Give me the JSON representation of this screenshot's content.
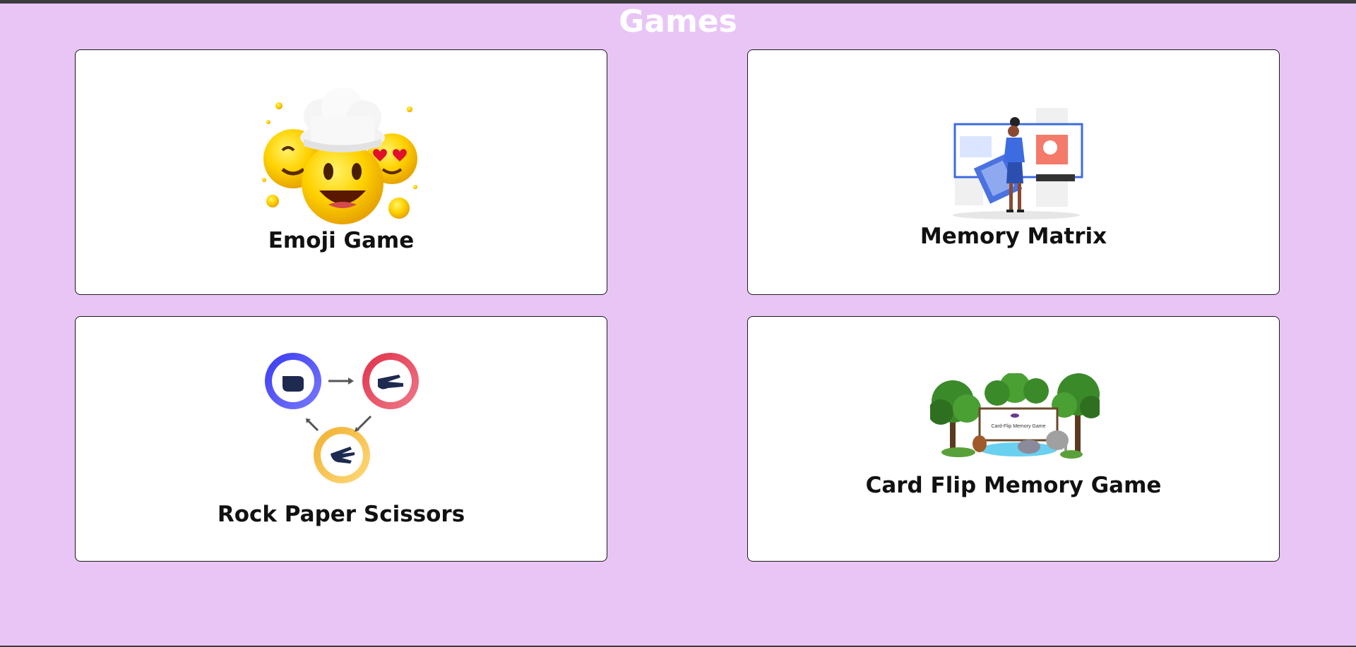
{
  "page": {
    "title": "Games"
  },
  "games": [
    {
      "label": "Emoji Game",
      "icon": "emoji-faces-icon"
    },
    {
      "label": "Memory Matrix",
      "icon": "memory-matrix-illustration"
    },
    {
      "label": "Rock Paper Scissors",
      "icon": "rock-paper-scissors-icon"
    },
    {
      "label": "Card Flip Memory Game",
      "icon": "card-flip-jungle-illustration"
    }
  ],
  "card_flip_banner_text": "Card-Flip Memory Game",
  "colors": {
    "background": "#e9c5f6",
    "card_background": "#ffffff",
    "title": "#ffffff",
    "label": "#111111"
  }
}
